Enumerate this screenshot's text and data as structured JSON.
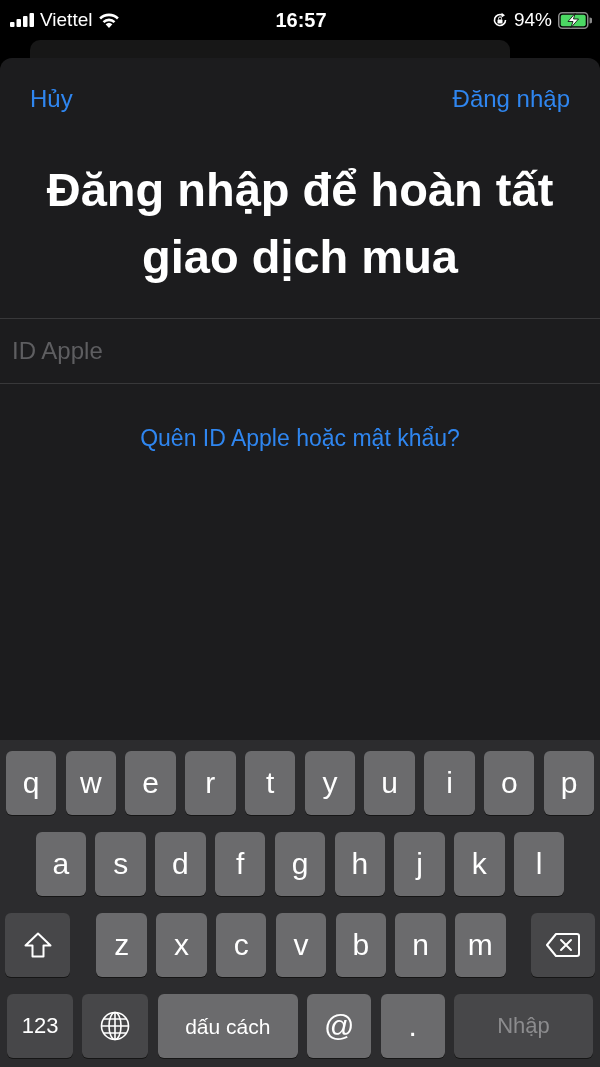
{
  "status_bar": {
    "carrier": "Viettel",
    "time": "16:57",
    "battery": "94%"
  },
  "sheet": {
    "cancel": "Hủy",
    "sign_in": "Đăng nhập",
    "title": "Đăng nhập để hoàn tất giao dịch mua",
    "field": {
      "placeholder": "ID Apple"
    },
    "forgot_link": "Quên ID Apple hoặc mật khẩu?"
  },
  "keyboard": {
    "rows": [
      {
        "keys": [
          {
            "kind": "letter",
            "label": "q"
          },
          {
            "kind": "letter",
            "label": "w"
          },
          {
            "kind": "letter",
            "label": "e"
          },
          {
            "kind": "letter",
            "label": "r"
          },
          {
            "kind": "letter",
            "label": "t"
          },
          {
            "kind": "letter",
            "label": "y"
          },
          {
            "kind": "letter",
            "label": "u"
          },
          {
            "kind": "letter",
            "label": "i"
          },
          {
            "kind": "letter",
            "label": "o"
          },
          {
            "kind": "letter",
            "label": "p"
          }
        ]
      },
      {
        "keys": [
          {
            "kind": "letter",
            "label": "a"
          },
          {
            "kind": "letter",
            "label": "s"
          },
          {
            "kind": "letter",
            "label": "d"
          },
          {
            "kind": "letter",
            "label": "f"
          },
          {
            "kind": "letter",
            "label": "g"
          },
          {
            "kind": "letter",
            "label": "h"
          },
          {
            "kind": "letter",
            "label": "j"
          },
          {
            "kind": "letter",
            "label": "k"
          },
          {
            "kind": "letter",
            "label": "l"
          }
        ]
      },
      {
        "keys": [
          {
            "kind": "shift"
          },
          {
            "kind": "letter",
            "label": "z"
          },
          {
            "kind": "letter",
            "label": "x"
          },
          {
            "kind": "letter",
            "label": "c"
          },
          {
            "kind": "letter",
            "label": "v"
          },
          {
            "kind": "letter",
            "label": "b"
          },
          {
            "kind": "letter",
            "label": "n"
          },
          {
            "kind": "letter",
            "label": "m"
          },
          {
            "kind": "delete"
          }
        ]
      },
      {
        "keys": [
          {
            "kind": "numbers",
            "label": "123"
          },
          {
            "kind": "globe"
          },
          {
            "kind": "space",
            "label": "dấu cách"
          },
          {
            "kind": "symbol",
            "label": "@"
          },
          {
            "kind": "symbol",
            "label": "."
          },
          {
            "kind": "return",
            "label": "Nhập",
            "disabled": true
          }
        ]
      }
    ]
  }
}
